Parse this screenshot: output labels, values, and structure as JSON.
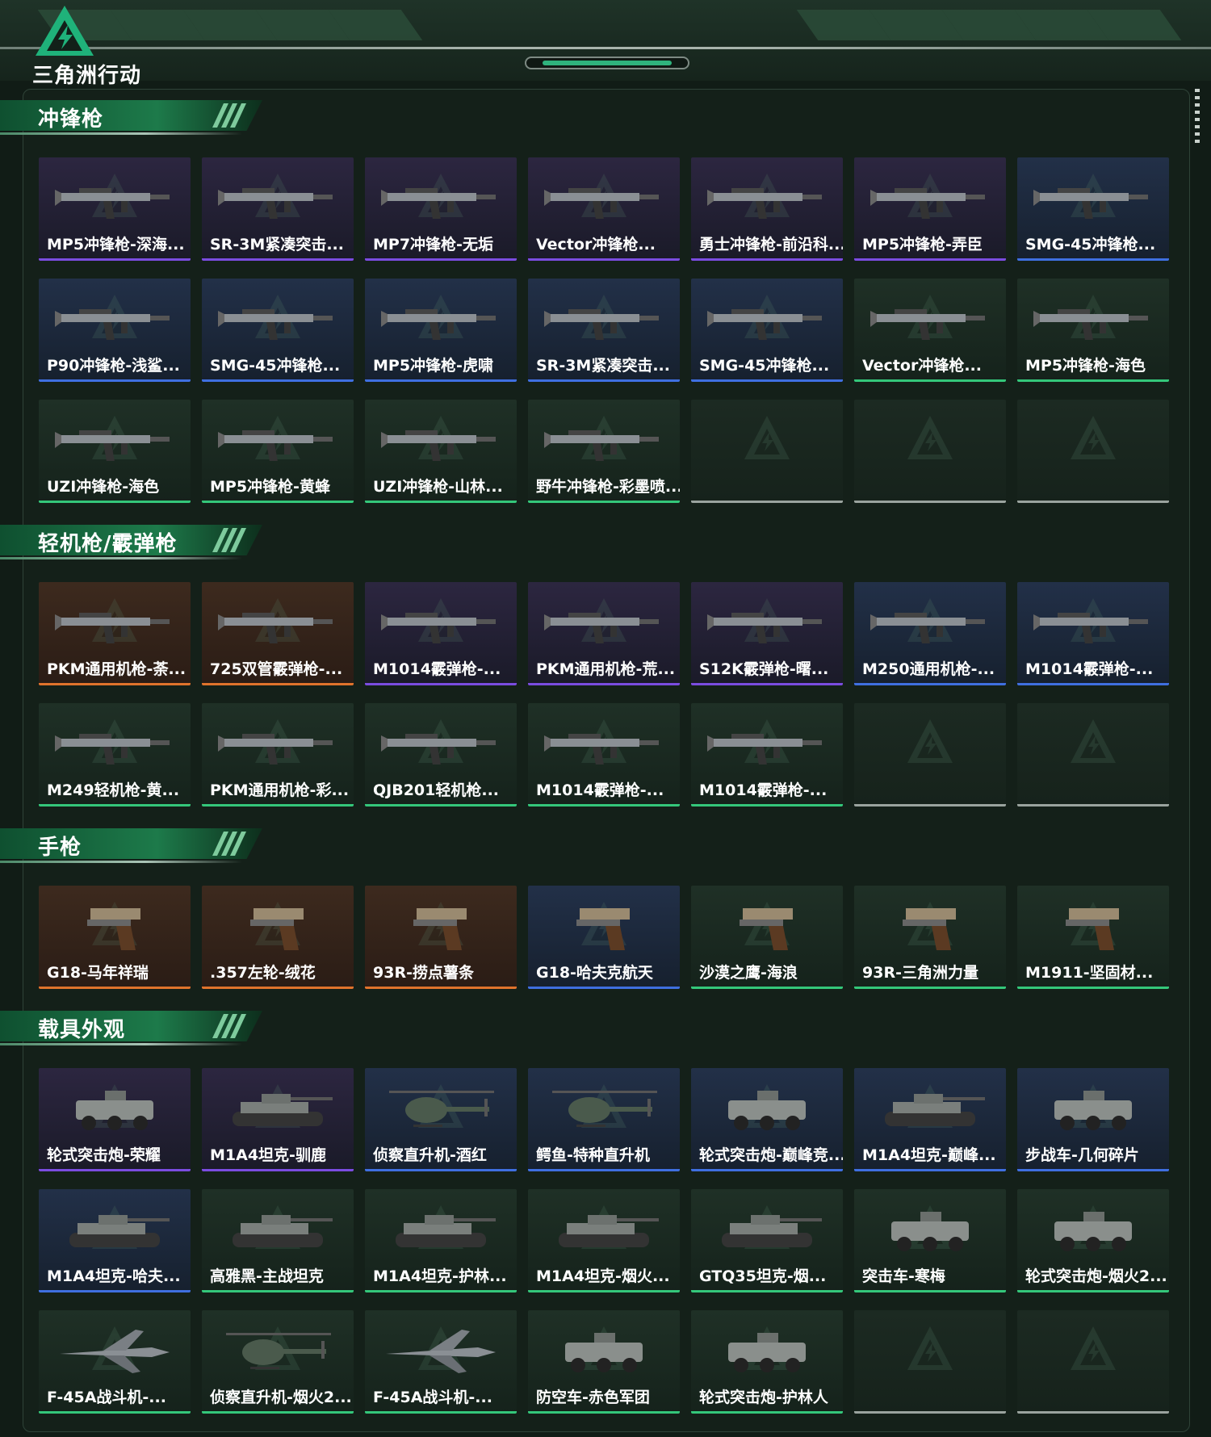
{
  "app": {
    "logo_text": "三角洲行动"
  },
  "colors": {
    "purple": "#7b4ce0",
    "blue": "#3f6fe0",
    "green": "#34c77a",
    "orange": "#e0732c",
    "empty": "#9aa39e"
  },
  "sections": [
    {
      "title": "冲锋枪",
      "rows": [
        [
          {
            "name": "MP5冲锋枪-深海...",
            "rarity": "purple",
            "icon": "gun-icon"
          },
          {
            "name": "SR-3M紧凑突击...",
            "rarity": "purple",
            "icon": "gun-icon"
          },
          {
            "name": "MP7冲锋枪-无垢",
            "rarity": "purple",
            "icon": "gun-icon"
          },
          {
            "name": "Vector冲锋枪...",
            "rarity": "purple",
            "icon": "gun-icon"
          },
          {
            "name": "勇士冲锋枪-前沿科...",
            "rarity": "purple",
            "icon": "gun-icon"
          },
          {
            "name": "MP5冲锋枪-弄臣",
            "rarity": "purple",
            "icon": "gun-icon"
          },
          {
            "name": "SMG-45冲锋枪...",
            "rarity": "blue",
            "icon": "gun-icon"
          }
        ],
        [
          {
            "name": "P90冲锋枪-浅鲨...",
            "rarity": "blue",
            "icon": "gun-icon"
          },
          {
            "name": "SMG-45冲锋枪...",
            "rarity": "blue",
            "icon": "gun-icon"
          },
          {
            "name": "MP5冲锋枪-虎啸",
            "rarity": "blue",
            "icon": "gun-icon"
          },
          {
            "name": "SR-3M紧凑突击...",
            "rarity": "blue",
            "icon": "gun-icon"
          },
          {
            "name": "SMG-45冲锋枪...",
            "rarity": "blue",
            "icon": "gun-icon"
          },
          {
            "name": "Vector冲锋枪...",
            "rarity": "green",
            "icon": "gun-icon"
          },
          {
            "name": "MP5冲锋枪-海色",
            "rarity": "green",
            "icon": "gun-icon"
          }
        ],
        [
          {
            "name": "UZI冲锋枪-海色",
            "rarity": "green",
            "icon": "gun-icon"
          },
          {
            "name": "MP5冲锋枪-黄蜂",
            "rarity": "green",
            "icon": "gun-icon"
          },
          {
            "name": "UZI冲锋枪-山林...",
            "rarity": "green",
            "icon": "gun-icon"
          },
          {
            "name": "野牛冲锋枪-彩墨喷...",
            "rarity": "green",
            "icon": "gun-icon"
          },
          {
            "name": "",
            "rarity": "empty",
            "icon": ""
          },
          {
            "name": "",
            "rarity": "empty",
            "icon": ""
          },
          {
            "name": "",
            "rarity": "empty",
            "icon": ""
          }
        ]
      ]
    },
    {
      "title": "轻机枪/霰弹枪",
      "rows": [
        [
          {
            "name": "PKM通用机枪-荼...",
            "rarity": "orange",
            "icon": "gun-icon"
          },
          {
            "name": "725双管霰弹枪-...",
            "rarity": "orange",
            "icon": "gun-icon"
          },
          {
            "name": "M1014霰弹枪-...",
            "rarity": "purple",
            "icon": "gun-icon"
          },
          {
            "name": "PKM通用机枪-荒...",
            "rarity": "purple",
            "icon": "gun-icon"
          },
          {
            "name": "S12K霰弹枪-曙...",
            "rarity": "purple",
            "icon": "gun-icon"
          },
          {
            "name": "M250通用机枪-...",
            "rarity": "blue",
            "icon": "gun-icon"
          },
          {
            "name": "M1014霰弹枪-...",
            "rarity": "blue",
            "icon": "gun-icon"
          }
        ],
        [
          {
            "name": "M249轻机枪-黄...",
            "rarity": "green",
            "icon": "gun-icon"
          },
          {
            "name": "PKM通用机枪-彩...",
            "rarity": "green",
            "icon": "gun-icon"
          },
          {
            "name": "QJB201轻机枪...",
            "rarity": "green",
            "icon": "gun-icon"
          },
          {
            "name": "M1014霰弹枪-...",
            "rarity": "green",
            "icon": "gun-icon"
          },
          {
            "name": "M1014霰弹枪-...",
            "rarity": "green",
            "icon": "gun-icon"
          },
          {
            "name": "",
            "rarity": "empty",
            "icon": ""
          },
          {
            "name": "",
            "rarity": "empty",
            "icon": ""
          }
        ]
      ]
    },
    {
      "title": "手枪",
      "rows": [
        [
          {
            "name": "G18-马年祥瑞",
            "rarity": "orange",
            "icon": "pistol-icon"
          },
          {
            "name": ".357左轮-绒花",
            "rarity": "orange",
            "icon": "pistol-icon"
          },
          {
            "name": "93R-捞点薯条",
            "rarity": "orange",
            "icon": "pistol-icon"
          },
          {
            "name": "G18-哈夫克航天",
            "rarity": "blue",
            "icon": "pistol-icon"
          },
          {
            "name": "沙漠之鹰-海浪",
            "rarity": "green",
            "icon": "pistol-icon"
          },
          {
            "name": "93R-三角洲力量",
            "rarity": "green",
            "icon": "pistol-icon"
          },
          {
            "name": "M1911-坚固材...",
            "rarity": "green",
            "icon": "pistol-icon"
          }
        ]
      ]
    },
    {
      "title": "载具外观",
      "rows": [
        [
          {
            "name": "轮式突击炮-荣耀",
            "rarity": "purple",
            "icon": "vehicle-icon"
          },
          {
            "name": "M1A4坦克-驯鹿",
            "rarity": "purple",
            "icon": "tank-icon"
          },
          {
            "name": "侦察直升机-酒红",
            "rarity": "blue",
            "icon": "helicopter-icon"
          },
          {
            "name": "鳄鱼-特种直升机",
            "rarity": "blue",
            "icon": "helicopter-icon"
          },
          {
            "name": "轮式突击炮-巅峰竞...",
            "rarity": "blue",
            "icon": "vehicle-icon"
          },
          {
            "name": "M1A4坦克-巅峰...",
            "rarity": "blue",
            "icon": "tank-icon"
          },
          {
            "name": "步战车-几何碎片",
            "rarity": "blue",
            "icon": "vehicle-icon"
          }
        ],
        [
          {
            "name": "M1A4坦克-哈夫...",
            "rarity": "blue",
            "icon": "tank-icon"
          },
          {
            "name": "高雅黑-主战坦克",
            "rarity": "green",
            "icon": "tank-icon"
          },
          {
            "name": "M1A4坦克-护林...",
            "rarity": "green",
            "icon": "tank-icon"
          },
          {
            "name": "M1A4坦克-烟火...",
            "rarity": "green",
            "icon": "tank-icon"
          },
          {
            "name": "GTQ35坦克-烟...",
            "rarity": "green",
            "icon": "tank-icon"
          },
          {
            "name": "突击车-寒梅",
            "rarity": "green",
            "icon": "vehicle-icon"
          },
          {
            "name": "轮式突击炮-烟火2...",
            "rarity": "green",
            "icon": "vehicle-icon"
          }
        ],
        [
          {
            "name": "F-45A战斗机-...",
            "rarity": "green",
            "icon": "jet-icon"
          },
          {
            "name": "侦察直升机-烟火2...",
            "rarity": "green",
            "icon": "helicopter-icon"
          },
          {
            "name": "F-45A战斗机-...",
            "rarity": "green",
            "icon": "jet-icon"
          },
          {
            "name": "防空车-赤色军团",
            "rarity": "green",
            "icon": "vehicle-icon"
          },
          {
            "name": "轮式突击炮-护林人",
            "rarity": "green",
            "icon": "vehicle-icon"
          },
          {
            "name": "",
            "rarity": "empty",
            "icon": ""
          },
          {
            "name": "",
            "rarity": "empty",
            "icon": ""
          }
        ]
      ]
    }
  ]
}
